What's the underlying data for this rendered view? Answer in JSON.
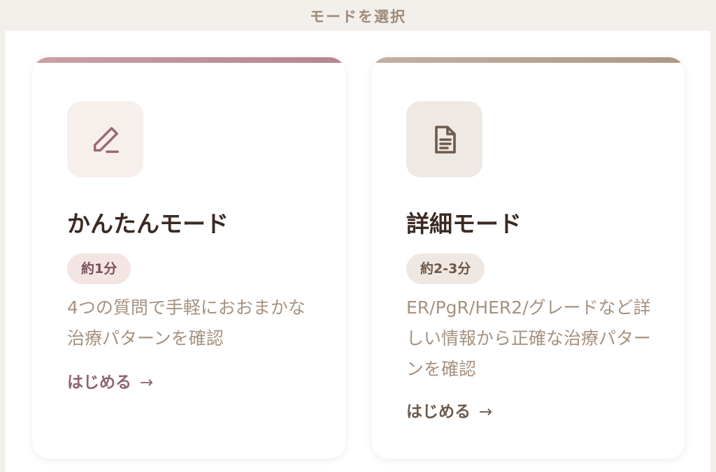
{
  "header": {
    "title": "モードを選択"
  },
  "modes": [
    {
      "icon": "pencil-icon",
      "title": "かんたんモード",
      "badge": "約1分",
      "description": "4つの質問で手軽におおまかな治療パターンを確認",
      "cta": "はじめる",
      "arrow": "→",
      "accent_color": "#b5848f"
    },
    {
      "icon": "document-icon",
      "title": "詳細モード",
      "badge": "約2-3分",
      "description": "ER/PgR/HER2/グレードなど詳しい情報から正確な治療パターンを確認",
      "cta": "はじめる",
      "arrow": "→",
      "accent_color": "#ad9886"
    }
  ]
}
